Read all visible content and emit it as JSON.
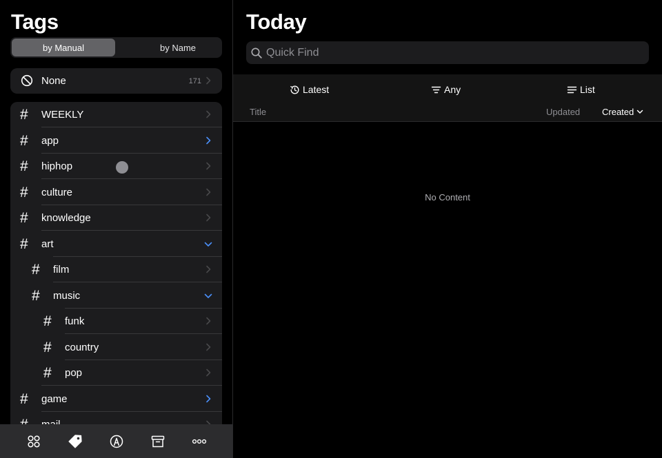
{
  "sidebar": {
    "title": "Tags",
    "sort_options": [
      "by Manual",
      "by Name"
    ],
    "none_item": {
      "label": "None",
      "count": "171"
    },
    "tags": [
      {
        "label": "WEEKLY",
        "level": 0,
        "chevron": "right",
        "accent": false
      },
      {
        "label": "app",
        "level": 0,
        "chevron": "right",
        "accent": true
      },
      {
        "label": "hiphop",
        "level": 0,
        "chevron": "right",
        "accent": false
      },
      {
        "label": "culture",
        "level": 0,
        "chevron": "right",
        "accent": false
      },
      {
        "label": "knowledge",
        "level": 0,
        "chevron": "right",
        "accent": false
      },
      {
        "label": "art",
        "level": 0,
        "chevron": "down",
        "accent": true
      },
      {
        "label": "film",
        "level": 1,
        "chevron": "right",
        "accent": false
      },
      {
        "label": "music",
        "level": 1,
        "chevron": "down",
        "accent": true
      },
      {
        "label": "funk",
        "level": 2,
        "chevron": "right",
        "accent": false
      },
      {
        "label": "country",
        "level": 2,
        "chevron": "right",
        "accent": false
      },
      {
        "label": "pop",
        "level": 2,
        "chevron": "right",
        "accent": false
      },
      {
        "label": "game",
        "level": 0,
        "chevron": "right",
        "accent": true
      },
      {
        "label": "mail",
        "level": 0,
        "chevron": "right",
        "accent": false
      }
    ],
    "toolbar_icons": [
      "grid-icon",
      "tag-icon",
      "person-circle-icon",
      "archive-icon",
      "more-icon"
    ]
  },
  "main": {
    "title": "Today",
    "search": {
      "placeholder": "Quick Find",
      "value": ""
    },
    "filters": {
      "latest": "Latest",
      "any": "Any",
      "list": "List"
    },
    "columns": {
      "title": "Title",
      "updated": "Updated",
      "created": "Created"
    },
    "empty_message": "No Content"
  },
  "colors": {
    "background": "#000000",
    "card": "#1c1c1e",
    "accent": "#4a8ef7",
    "muted": "#8e8e93"
  }
}
